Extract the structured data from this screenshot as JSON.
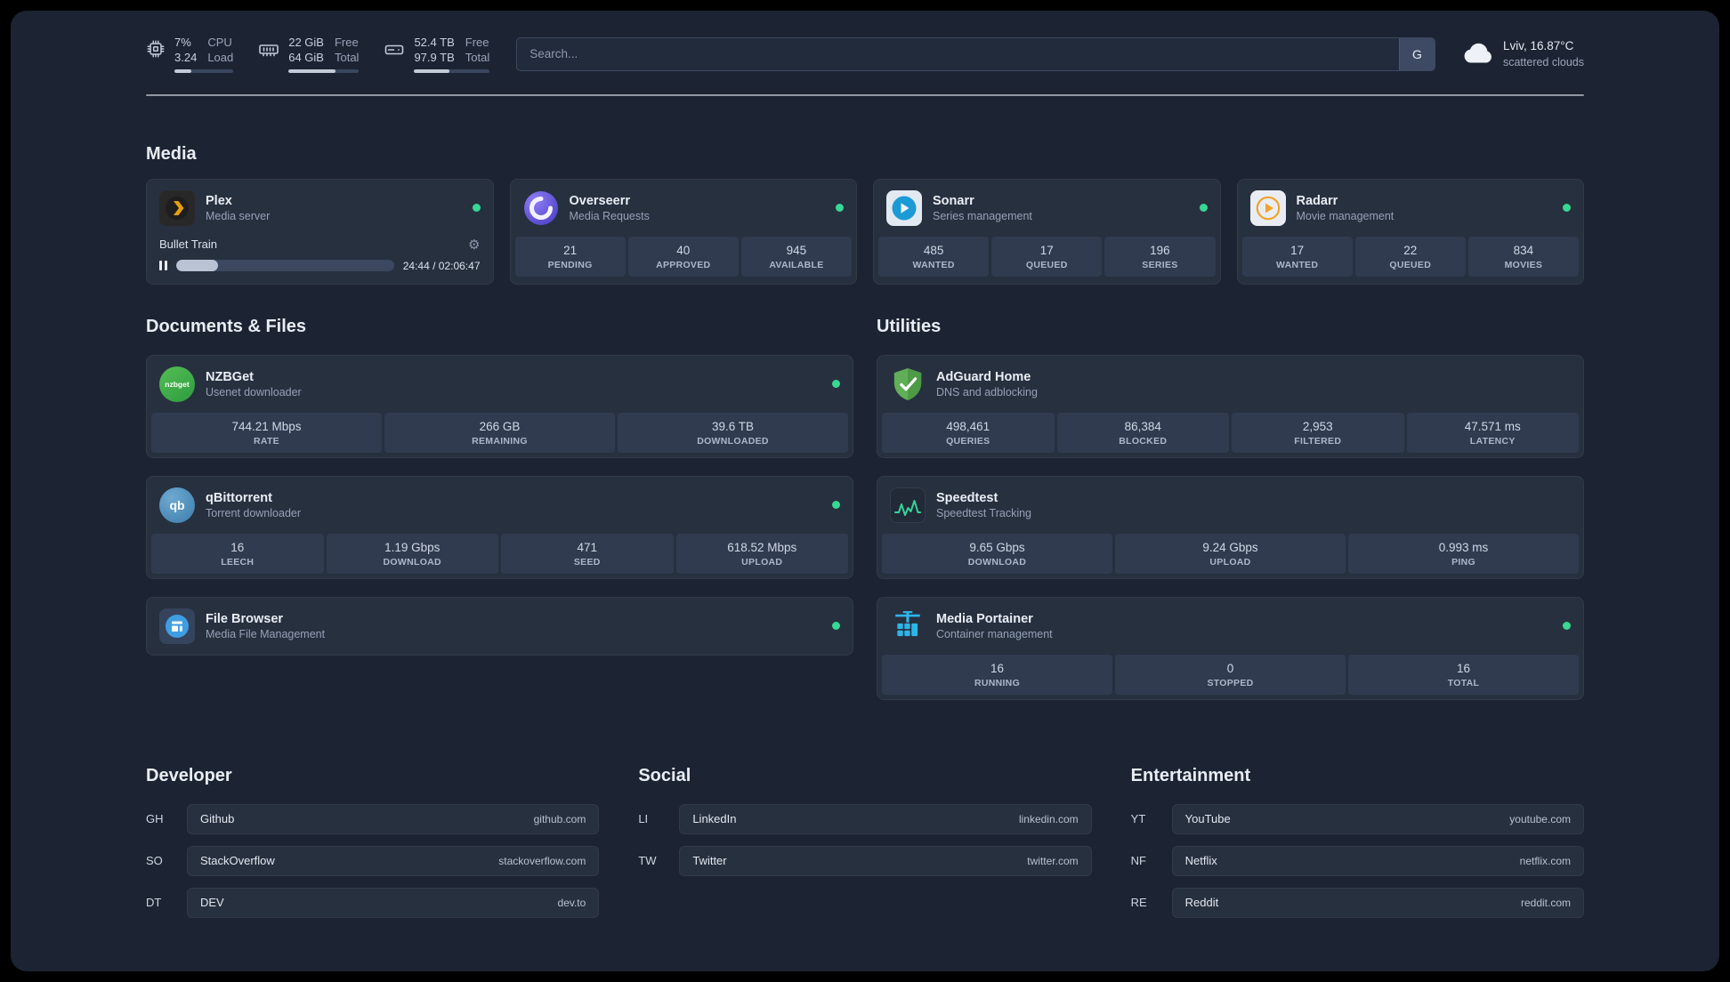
{
  "topbar": {
    "cpu": {
      "value_top": "7%",
      "value_bottom": "3.24",
      "label_top": "CPU",
      "label_bottom": "Load"
    },
    "memory": {
      "value_top": "22 GiB",
      "value_bottom": "64 GiB",
      "label_top": "Free",
      "label_bottom": "Total"
    },
    "disk": {
      "value_top": "52.4 TB",
      "value_bottom": "97.9 TB",
      "label_top": "Free",
      "label_bottom": "Total"
    },
    "search": {
      "placeholder": "Search...",
      "button": "G"
    },
    "weather": {
      "location": "Lviv, 16.87°C",
      "condition": "scattered clouds"
    }
  },
  "sections": {
    "media": {
      "title": "Media"
    },
    "documents": {
      "title": "Documents & Files"
    },
    "utilities": {
      "title": "Utilities"
    }
  },
  "services": {
    "plex": {
      "name": "Plex",
      "description": "Media server",
      "now_playing": "Bullet Train",
      "time": "24:44 / 02:06:47"
    },
    "overseerr": {
      "name": "Overseerr",
      "description": "Media Requests",
      "stats": [
        {
          "value": "21",
          "label": "PENDING"
        },
        {
          "value": "40",
          "label": "APPROVED"
        },
        {
          "value": "945",
          "label": "AVAILABLE"
        }
      ]
    },
    "sonarr": {
      "name": "Sonarr",
      "description": "Series management",
      "stats": [
        {
          "value": "485",
          "label": "WANTED"
        },
        {
          "value": "17",
          "label": "QUEUED"
        },
        {
          "value": "196",
          "label": "SERIES"
        }
      ]
    },
    "radarr": {
      "name": "Radarr",
      "description": "Movie management",
      "stats": [
        {
          "value": "17",
          "label": "WANTED"
        },
        {
          "value": "22",
          "label": "QUEUED"
        },
        {
          "value": "834",
          "label": "MOVIES"
        }
      ]
    },
    "nzbget": {
      "name": "NZBGet",
      "description": "Usenet downloader",
      "icon_text": "nzbget",
      "stats": [
        {
          "value": "744.21 Mbps",
          "label": "RATE"
        },
        {
          "value": "266 GB",
          "label": "REMAINING"
        },
        {
          "value": "39.6 TB",
          "label": "DOWNLOADED"
        }
      ]
    },
    "qbittorrent": {
      "name": "qBittorrent",
      "description": "Torrent downloader",
      "icon_text": "qb",
      "stats": [
        {
          "value": "16",
          "label": "LEECH"
        },
        {
          "value": "1.19 Gbps",
          "label": "DOWNLOAD"
        },
        {
          "value": "471",
          "label": "SEED"
        },
        {
          "value": "618.52 Mbps",
          "label": "UPLOAD"
        }
      ]
    },
    "filebrowser": {
      "name": "File Browser",
      "description": "Media File Management"
    },
    "adguard": {
      "name": "AdGuard Home",
      "description": "DNS and adblocking",
      "stats": [
        {
          "value": "498,461",
          "label": "QUERIES"
        },
        {
          "value": "86,384",
          "label": "BLOCKED"
        },
        {
          "value": "2,953",
          "label": "FILTERED"
        },
        {
          "value": "47.571 ms",
          "label": "LATENCY"
        }
      ]
    },
    "speedtest": {
      "name": "Speedtest",
      "description": "Speedtest Tracking",
      "stats": [
        {
          "value": "9.65 Gbps",
          "label": "DOWNLOAD"
        },
        {
          "value": "9.24 Gbps",
          "label": "UPLOAD"
        },
        {
          "value": "0.993 ms",
          "label": "PING"
        }
      ]
    },
    "portainer": {
      "name": "Media Portainer",
      "description": "Container management",
      "stats": [
        {
          "value": "16",
          "label": "RUNNING"
        },
        {
          "value": "0",
          "label": "STOPPED"
        },
        {
          "value": "16",
          "label": "TOTAL"
        }
      ]
    }
  },
  "bookmarks": [
    {
      "title": "Developer",
      "items": [
        {
          "abbr": "GH",
          "name": "Github",
          "domain": "github.com"
        },
        {
          "abbr": "SO",
          "name": "StackOverflow",
          "domain": "stackoverflow.com"
        },
        {
          "abbr": "DT",
          "name": "DEV",
          "domain": "dev.to"
        }
      ]
    },
    {
      "title": "Social",
      "items": [
        {
          "abbr": "LI",
          "name": "LinkedIn",
          "domain": "linkedin.com"
        },
        {
          "abbr": "TW",
          "name": "Twitter",
          "domain": "twitter.com"
        }
      ]
    },
    {
      "title": "Entertainment",
      "items": [
        {
          "abbr": "YT",
          "name": "YouTube",
          "domain": "youtube.com"
        },
        {
          "abbr": "NF",
          "name": "Netflix",
          "domain": "netflix.com"
        },
        {
          "abbr": "RE",
          "name": "Reddit",
          "domain": "reddit.com"
        }
      ]
    }
  ],
  "colors": {
    "status_online": "#38d793",
    "accent_green": "#34d399"
  }
}
